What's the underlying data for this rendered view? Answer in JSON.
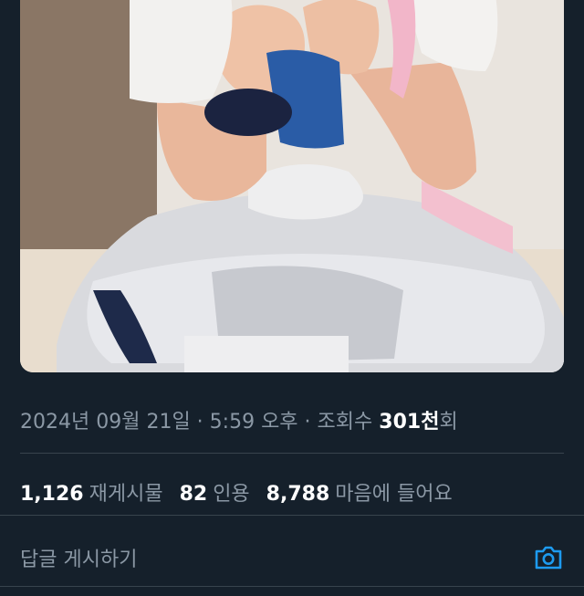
{
  "tweet": {
    "date": "2024년 09월 21일",
    "sep1": " · ",
    "time": "5:59 오후",
    "sep2": " · ",
    "views_label": "조회수 ",
    "views_value": "301천",
    "views_suffix": "회"
  },
  "stats": {
    "retweets_value": "1,126",
    "retweets_label": "재게시물",
    "quotes_value": "82",
    "quotes_label": "인용",
    "likes_value": "8,788",
    "likes_label": "마음에 들어요"
  },
  "reply": {
    "placeholder": "답글 게시하기",
    "camera_icon": "camera-icon"
  },
  "colors": {
    "background": "#15202b",
    "accent": "#1d9bf0",
    "muted": "#8b98a5",
    "divider": "#38444d"
  }
}
